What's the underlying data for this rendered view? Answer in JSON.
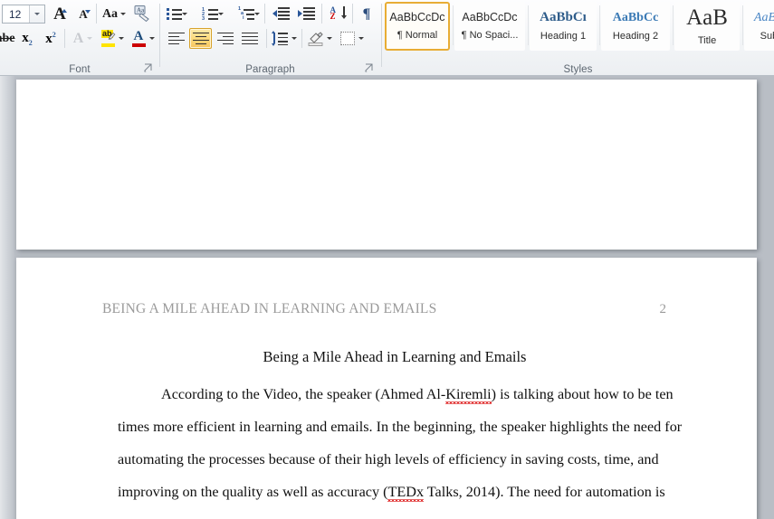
{
  "ribbon": {
    "groups": [
      {
        "id": "font",
        "label": "Font"
      },
      {
        "id": "paragraph",
        "label": "Paragraph"
      },
      {
        "id": "styles",
        "label": "Styles"
      }
    ],
    "font_group": {
      "font_size_value": "12",
      "font_size_dropdown": "chevron-down-icon",
      "grow_font": "Grow Font",
      "shrink_font": "Shrink Font",
      "change_case": "Aa",
      "clear_formatting": "Clear Formatting",
      "strikethrough": "Strikethrough",
      "subscript": "x",
      "subscript_idx": "2",
      "superscript": "x",
      "superscript_idx": "2",
      "text_effects": "A",
      "highlight_label": "ab",
      "highlight_color": "#ffe400",
      "font_color_label": "A",
      "font_color": "#cc0000",
      "dialog_launcher": "font-dialog-launcher"
    },
    "paragraph_group": {
      "bullets": "Bullets",
      "numbering": "Numbering",
      "multilevel_list": "Multilevel List",
      "decrease_indent": "Decrease Indent",
      "increase_indent": "Increase Indent",
      "sort": "Sort",
      "show_marks": "¶",
      "align_left": "Align Text Left",
      "align_center": "Center",
      "align_right": "Align Text Right",
      "justify": "Justify",
      "line_spacing": "Line and Paragraph Spacing",
      "shading": "Shading",
      "borders": "Borders",
      "active_button": "align_center",
      "dialog_launcher": "paragraph-dialog-launcher"
    },
    "styles_group": {
      "selected": "Normal",
      "items": [
        {
          "name": "Normal",
          "preview": "AaBbCcDc",
          "mark": "¶ ",
          "kind": "normal"
        },
        {
          "name": "No Spaci...",
          "preview": "AaBbCcDc",
          "mark": "¶ ",
          "kind": "normal"
        },
        {
          "name": "Heading 1",
          "preview": "AaBbCı",
          "mark": "",
          "kind": "h1"
        },
        {
          "name": "Heading 2",
          "preview": "AaBbCc",
          "mark": "",
          "kind": "h2"
        },
        {
          "name": "Title",
          "preview": "AaB",
          "mark": "",
          "kind": "title"
        },
        {
          "name": "Subtitle",
          "preview": "AaBbCc.",
          "mark": "",
          "kind": "subtitle"
        },
        {
          "name": "Su",
          "preview": "Aa",
          "mark": "",
          "kind": "subtle"
        }
      ]
    }
  },
  "document": {
    "page1": {
      "empty": true
    },
    "page2": {
      "running_header": "BEING A MILE AHEAD IN LEARNING AND EMAILS",
      "page_number": "2",
      "title": "Being a Mile Ahead in Learning and Emails",
      "paragraph_lines": [
        {
          "indent": true,
          "parts": [
            {
              "t": "According to the Video, the speaker (Ahmed Al-"
            },
            {
              "t": "Kiremli",
              "spell": true
            },
            {
              "t": ") is talking about how to be ten"
            }
          ]
        },
        {
          "indent": false,
          "parts": [
            {
              "t": "times more efficient in learning and emails.  In the beginning, the speaker highlights the need for"
            }
          ]
        },
        {
          "indent": false,
          "parts": [
            {
              "t": "automating the processes because of their high levels of efficiency in saving costs, time, and"
            }
          ]
        },
        {
          "indent": false,
          "parts": [
            {
              "t": "improving on the quality as well as accuracy ("
            },
            {
              "t": "TEDx",
              "spell": true
            },
            {
              "t": " Talks, 2014). The need for automation is"
            }
          ]
        }
      ]
    }
  },
  "colors": {
    "ribbon_bg": "#f3f5f7",
    "selection_gold": "#e8ad34",
    "page_bg_gray": "#b9bec5",
    "header_gray": "#9a9a9a",
    "spell_error_red": "#e03030",
    "heading_blue": "#2e5c8a"
  }
}
